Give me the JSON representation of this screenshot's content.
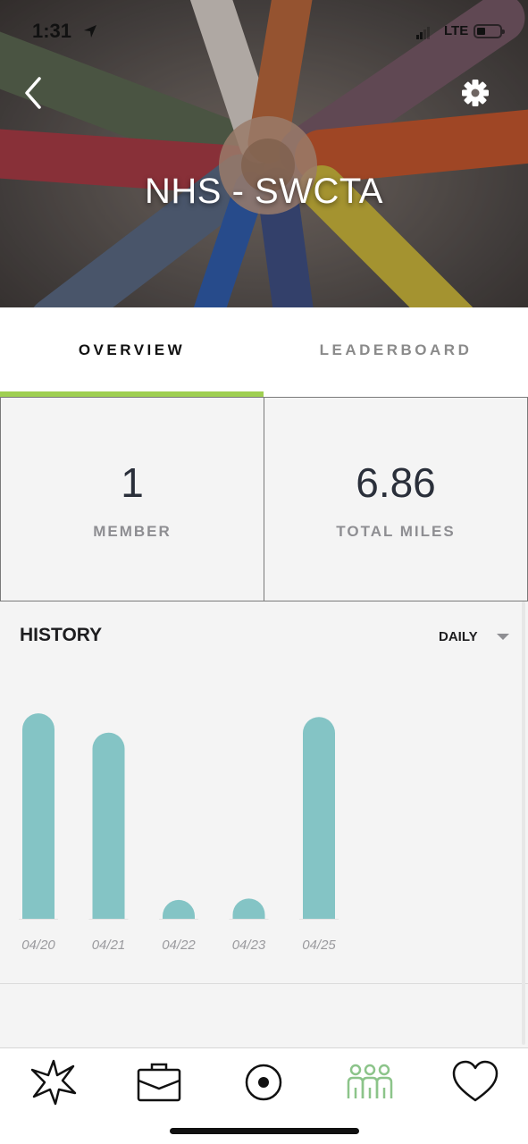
{
  "status_bar": {
    "time": "1:31",
    "network": "LTE",
    "icons": [
      "location-arrow-icon",
      "signal-icon",
      "battery-icon"
    ]
  },
  "header": {
    "title": "NHS - SWCTA",
    "back_icon": "chevron-left-icon",
    "settings_icon": "gear-icon"
  },
  "tabs": [
    {
      "label": "OVERVIEW",
      "active": true
    },
    {
      "label": "LEADERBOARD",
      "active": false
    }
  ],
  "stats": {
    "members": {
      "value": "1",
      "label": "MEMBER"
    },
    "miles": {
      "value": "6.86",
      "label": "TOTAL MILES"
    }
  },
  "history": {
    "title": "HISTORY",
    "range": "DAILY"
  },
  "chart_data": {
    "type": "bar",
    "title": "",
    "xlabel": "",
    "ylabel": "",
    "categories": [
      "04/20",
      "04/21",
      "04/22",
      "04/23",
      "04/25"
    ],
    "values": [
      2.24,
      2.03,
      0.06,
      0.09,
      2.2
    ],
    "ylim": [
      0,
      2.3
    ],
    "grid": false,
    "bar_color": "#84c4c5"
  },
  "bottom_nav": [
    {
      "icon": "burst-icon",
      "active": false
    },
    {
      "icon": "briefcase-icon",
      "active": false
    },
    {
      "icon": "record-icon",
      "active": false
    },
    {
      "icon": "team-icon",
      "active": true
    },
    {
      "icon": "heart-icon",
      "active": false
    }
  ],
  "colors": {
    "accent": "#9fcf52",
    "bar": "#84c4c5",
    "nav_active": "#8cc48a"
  }
}
